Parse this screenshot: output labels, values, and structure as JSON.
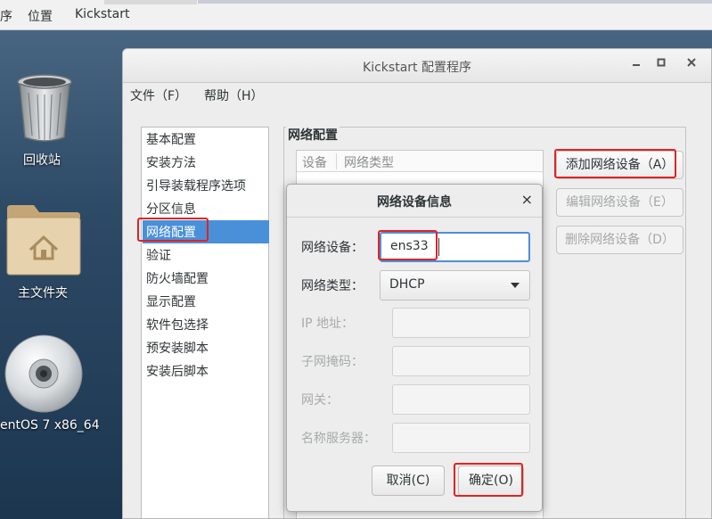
{
  "top_panel": {
    "menu_programs": "序",
    "menu_places": "位置",
    "menu_app": "Kickstart"
  },
  "desktop": {
    "icons": [
      {
        "label": "回收站"
      },
      {
        "label": "主文件夹"
      },
      {
        "label": "entOS 7 x86_64"
      }
    ]
  },
  "window": {
    "title": "Kickstart 配置程序",
    "menu": {
      "file": "文件（F）",
      "help": "帮助（H）"
    },
    "sidebar": {
      "selected_index": 4,
      "items": [
        "基本配置",
        "安装方法",
        "引导装载程序选项",
        "分区信息",
        "网络配置",
        "验证",
        "防火墙配置",
        "显示配置",
        "软件包选择",
        "预安装脚本",
        "安装后脚本"
      ]
    },
    "network": {
      "legend": "网络配置",
      "columns": [
        "设备",
        "网络类型"
      ],
      "buttons": {
        "add": "添加网络设备（A）",
        "edit": "编辑网络设备（E）",
        "delete": "删除网络设备（D）"
      }
    }
  },
  "dialog": {
    "title": "网络设备信息",
    "close": "×",
    "device_label": "网络设备：",
    "device_value": "ens33",
    "type_label": "网络类型：",
    "type_value": "DHCP",
    "ip_label": "IP 地址：",
    "mask_label": "子网掩码：",
    "gateway_label": "网关：",
    "dns_label": "名称服务器：",
    "cancel": "取消(C)",
    "ok": "确定(O)"
  },
  "colors": {
    "selection": "#4a90d9",
    "highlight": "#e02323"
  }
}
